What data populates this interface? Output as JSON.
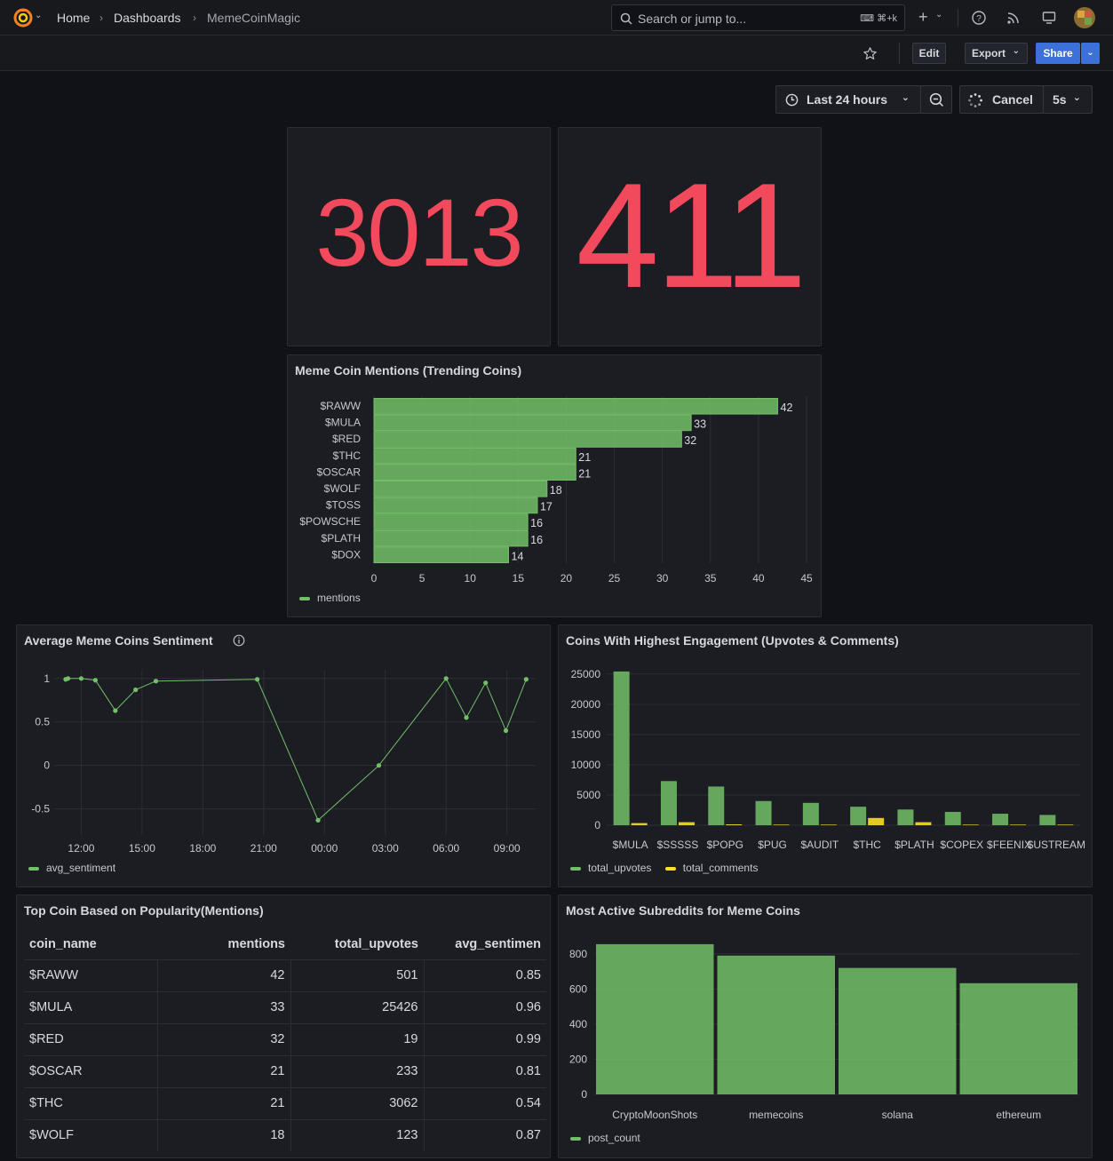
{
  "header": {
    "breadcrumbs": [
      "Home",
      "Dashboards",
      "MemeCoinMagic"
    ],
    "search_placeholder": "Search or jump to...",
    "search_shortcut": "⌘+k"
  },
  "toolbar": {
    "edit": "Edit",
    "export": "Export",
    "share": "Share"
  },
  "time_controls": {
    "range": "Last 24 hours",
    "cancel": "Cancel",
    "refresh": "5s"
  },
  "stats": {
    "stat1": "3013",
    "stat2": "411"
  },
  "mentions_panel": {
    "title": "Meme Coin Mentions (Trending Coins)",
    "chart_data": {
      "type": "bar",
      "orientation": "horizontal",
      "categories": [
        "$RAWW",
        "$MULA",
        "$RED",
        "$THC",
        "$OSCAR",
        "$WOLF",
        "$TOSS",
        "$POWSCHE",
        "$PLATH",
        "$DOX"
      ],
      "series": [
        {
          "name": "mentions",
          "values": [
            42,
            33,
            32,
            21,
            21,
            18,
            17,
            16,
            16,
            14
          ]
        }
      ],
      "xlim": [
        0,
        45
      ],
      "xticks": [
        0,
        5,
        10,
        15,
        20,
        25,
        30,
        35,
        40,
        45
      ],
      "colors": {
        "bar": "#73bf69"
      },
      "legend": "bottom-left"
    }
  },
  "sentiment_panel": {
    "title": "Average Meme Coins Sentiment",
    "chart_data": {
      "type": "line",
      "series": [
        {
          "name": "avg_sentiment",
          "points": [
            [
              "11:14",
              0.99
            ],
            [
              "11:21",
              1.0
            ],
            [
              "12:00",
              1.0
            ],
            [
              "12:42",
              0.98
            ],
            [
              "13:41",
              0.63
            ],
            [
              "14:41",
              0.87
            ],
            [
              "15:41",
              0.97
            ],
            [
              "20:41",
              0.99
            ],
            [
              "23:41",
              -0.63
            ],
            [
              "02:41",
              0.0
            ],
            [
              "06:00",
              1.0
            ],
            [
              "07:00",
              0.55
            ],
            [
              "07:57",
              0.95
            ],
            [
              "08:57",
              0.4
            ],
            [
              "09:57",
              0.99
            ]
          ]
        }
      ],
      "xticks": [
        "12:00",
        "15:00",
        "18:00",
        "21:00",
        "00:00",
        "03:00",
        "06:00",
        "09:00"
      ],
      "yticks": [
        "1",
        "0.5",
        "0",
        "-0.5"
      ],
      "ylim": [
        -0.8,
        1.1
      ],
      "colors": {
        "line": "#73bf69"
      },
      "legend": "bottom-left"
    }
  },
  "engagement_panel": {
    "title": "Coins With Highest Engagement (Upvotes & Comments)",
    "chart_data": {
      "type": "bar",
      "categories": [
        "$MULA",
        "$SSSSS",
        "$POPG",
        "$PUG",
        "$AUDIT",
        "$THC",
        "$PLATH",
        "$COPEX",
        "$FEENIX",
        "$USTREAM"
      ],
      "series": [
        {
          "name": "total_upvotes",
          "values": [
            25426,
            7300,
            6400,
            4000,
            3700,
            3062,
            2600,
            2200,
            1900,
            1700
          ]
        },
        {
          "name": "total_comments",
          "values": [
            350,
            500,
            150,
            100,
            100,
            1200,
            500,
            100,
            100,
            100
          ]
        }
      ],
      "yticks": [
        "25000",
        "20000",
        "15000",
        "10000",
        "5000",
        "0"
      ],
      "ylim": [
        0,
        26000
      ],
      "colors": {
        "total_upvotes": "#73bf69",
        "total_comments": "#fade2a"
      },
      "legend": "bottom-left"
    }
  },
  "table_panel": {
    "title": "Top Coin Based on Popularity(Mentions)",
    "columns": [
      "coin_name",
      "mentions",
      "total_upvotes",
      "avg_sentimen"
    ],
    "rows": [
      [
        "$RAWW",
        "42",
        "501",
        "0.85"
      ],
      [
        "$MULA",
        "33",
        "25426",
        "0.96"
      ],
      [
        "$RED",
        "32",
        "19",
        "0.99"
      ],
      [
        "$OSCAR",
        "21",
        "233",
        "0.81"
      ],
      [
        "$THC",
        "21",
        "3062",
        "0.54"
      ],
      [
        "$WOLF",
        "18",
        "123",
        "0.87"
      ]
    ]
  },
  "subreddit_panel": {
    "title": "Most Active Subreddits for Meme Coins",
    "chart_data": {
      "type": "bar",
      "categories": [
        "CryptoMoonShots",
        "memecoins",
        "solana",
        "ethereum"
      ],
      "series": [
        {
          "name": "post_count",
          "values": [
            855,
            790,
            720,
            633
          ]
        }
      ],
      "yticks": [
        "800",
        "600",
        "400",
        "200",
        "0"
      ],
      "ylim": [
        0,
        880
      ],
      "colors": {
        "bar": "#73bf69"
      },
      "legend": "bottom-left"
    }
  }
}
